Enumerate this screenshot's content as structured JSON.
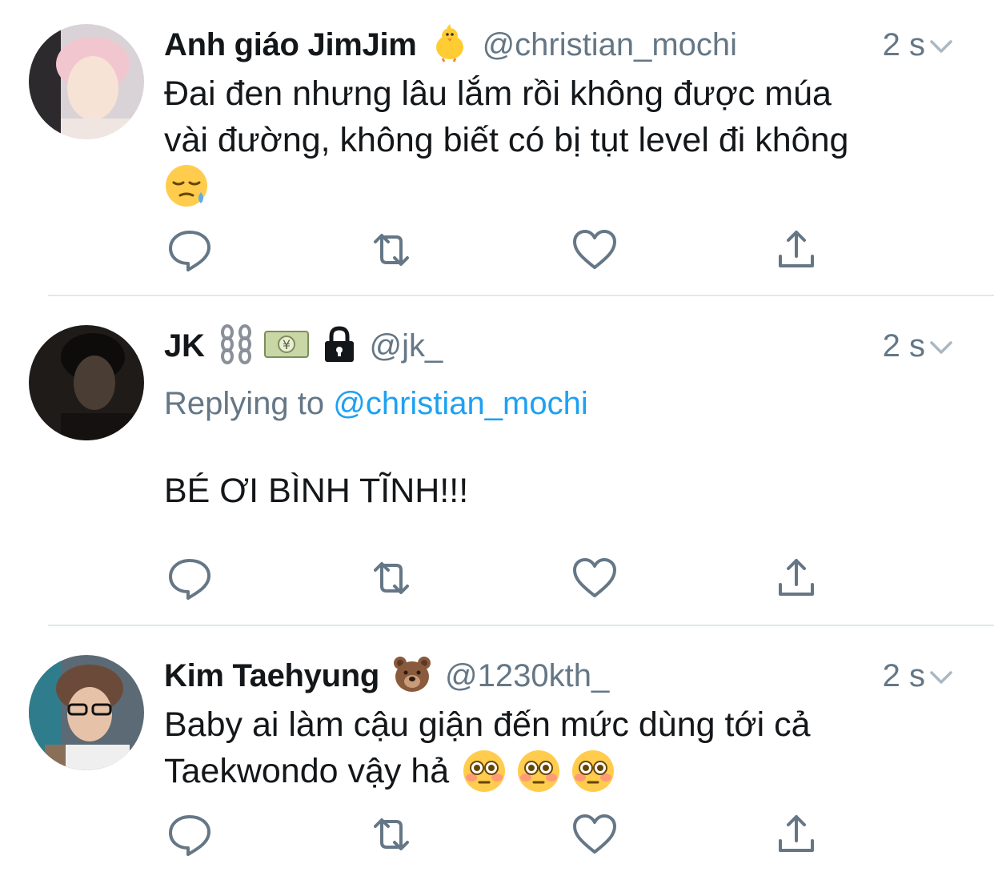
{
  "tweets": [
    {
      "name": "Anh giáo JimJim",
      "name_emoji": "chick-emoji",
      "handle": "@christian_mochi",
      "time": "2 s",
      "text_lines": [
        "Đai đen nhưng lâu lắm rồi không được múa",
        "vài đường, không biết có bị tụt level đi không"
      ],
      "trailing_emoji": "sleepy-face-emoji"
    },
    {
      "name": "JK",
      "name_emoji": [
        "chains-emoji",
        "yen-banknote-emoji",
        "lock-emoji"
      ],
      "handle": "@jk_",
      "time": "2 s",
      "replying_prefix": "Replying to",
      "replying_mention": "@christian_mochi",
      "text": "BÉ ƠI BÌNH TĨNH!!!"
    },
    {
      "name": "Kim Taehyung",
      "name_emoji": "bear-face-emoji",
      "handle": "@1230kth_",
      "time": "2 s",
      "text_lines": [
        "Baby ai làm cậu giận đến mức dùng tới cả",
        "Taekwondo vậy hả"
      ],
      "trailing_emoji": [
        "flushed-face-emoji",
        "flushed-face-emoji",
        "flushed-face-emoji"
      ]
    }
  ],
  "actions": [
    "reply-icon",
    "retweet-icon",
    "like-icon",
    "share-icon"
  ],
  "colors": {
    "text": "#14171a",
    "secondary": "#657786",
    "link": "#1da1f2",
    "divider": "#e1e8ed"
  }
}
